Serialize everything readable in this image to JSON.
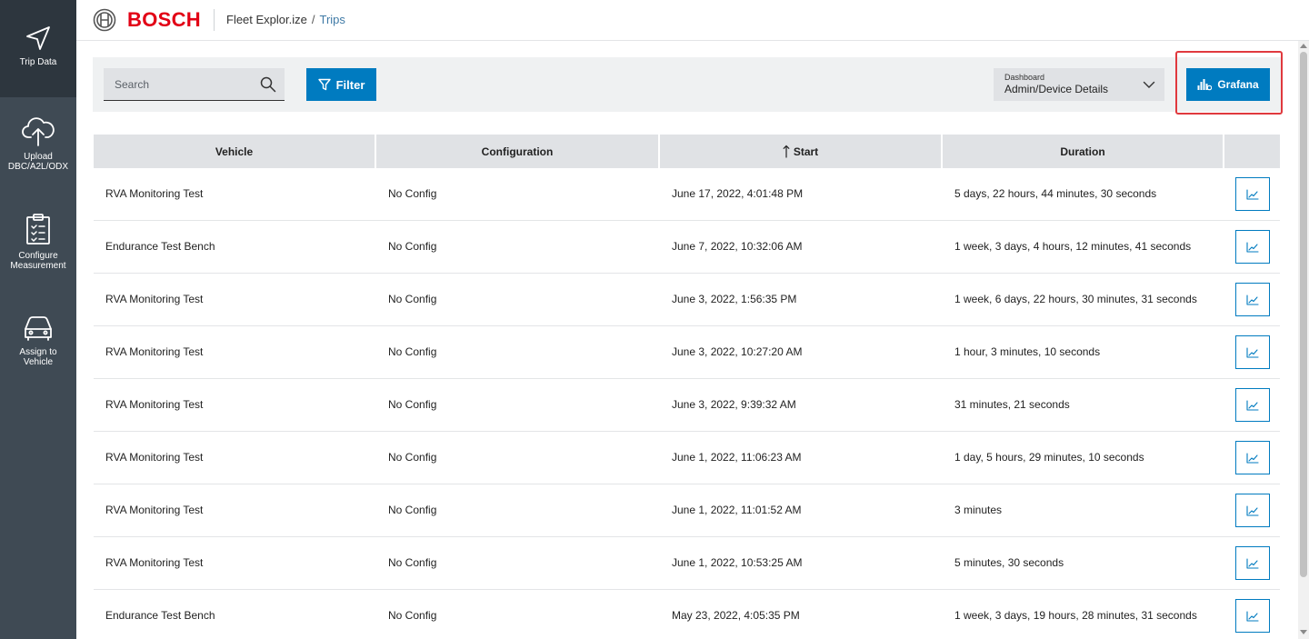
{
  "sidebar": {
    "items": [
      {
        "label": "Trip Data",
        "icon": "navigation-arrow-icon",
        "active": true
      },
      {
        "label": "Upload DBC/A2L/ODX",
        "icon": "cloud-upload-icon",
        "active": false
      },
      {
        "label": "Configure Measurement",
        "icon": "clipboard-checklist-icon",
        "active": false
      },
      {
        "label": "Assign to Vehicle",
        "icon": "car-icon",
        "active": false
      }
    ]
  },
  "header": {
    "brand": "BOSCH",
    "app_name": "Fleet Explor.ize",
    "separator": "/",
    "page": "Trips"
  },
  "toolbar": {
    "search_placeholder": "Search",
    "filter_label": "Filter",
    "dashboard_label": "Dashboard",
    "dashboard_value": "Admin/Device Details",
    "grafana_label": "Grafana"
  },
  "table": {
    "columns": [
      "Vehicle",
      "Configuration",
      "Start",
      "Duration",
      ""
    ],
    "sorted_column": "Start",
    "rows": [
      {
        "vehicle": "RVA Monitoring Test",
        "config": "No Config",
        "start": "June 17, 2022, 4:01:48 PM",
        "duration": "5 days, 22 hours, 44 minutes, 30 seconds"
      },
      {
        "vehicle": "Endurance Test Bench",
        "config": "No Config",
        "start": "June 7, 2022, 10:32:06 AM",
        "duration": "1 week, 3 days, 4 hours, 12 minutes, 41 seconds"
      },
      {
        "vehicle": "RVA Monitoring Test",
        "config": "No Config",
        "start": "June 3, 2022, 1:56:35 PM",
        "duration": "1 week, 6 days, 22 hours, 30 minutes, 31 seconds"
      },
      {
        "vehicle": "RVA Monitoring Test",
        "config": "No Config",
        "start": "June 3, 2022, 10:27:20 AM",
        "duration": "1 hour, 3 minutes, 10 seconds"
      },
      {
        "vehicle": "RVA Monitoring Test",
        "config": "No Config",
        "start": "June 3, 2022, 9:39:32 AM",
        "duration": "31 minutes, 21 seconds"
      },
      {
        "vehicle": "RVA Monitoring Test",
        "config": "No Config",
        "start": "June 1, 2022, 11:06:23 AM",
        "duration": "1 day, 5 hours, 29 minutes, 10 seconds"
      },
      {
        "vehicle": "RVA Monitoring Test",
        "config": "No Config",
        "start": "June 1, 2022, 11:01:52 AM",
        "duration": "3 minutes"
      },
      {
        "vehicle": "RVA Monitoring Test",
        "config": "No Config",
        "start": "June 1, 2022, 10:53:25 AM",
        "duration": "5 minutes, 30 seconds"
      },
      {
        "vehicle": "Endurance Test Bench",
        "config": "No Config",
        "start": "May 23, 2022, 4:05:35 PM",
        "duration": "1 week, 3 days, 19 hours, 28 minutes, 31 seconds"
      }
    ]
  },
  "colors": {
    "sidebar_bg": "#3f4a54",
    "sidebar_active": "#2d363e",
    "brand_red": "#e20015",
    "primary_blue": "#007bc0",
    "highlight_red": "#e0393e"
  }
}
